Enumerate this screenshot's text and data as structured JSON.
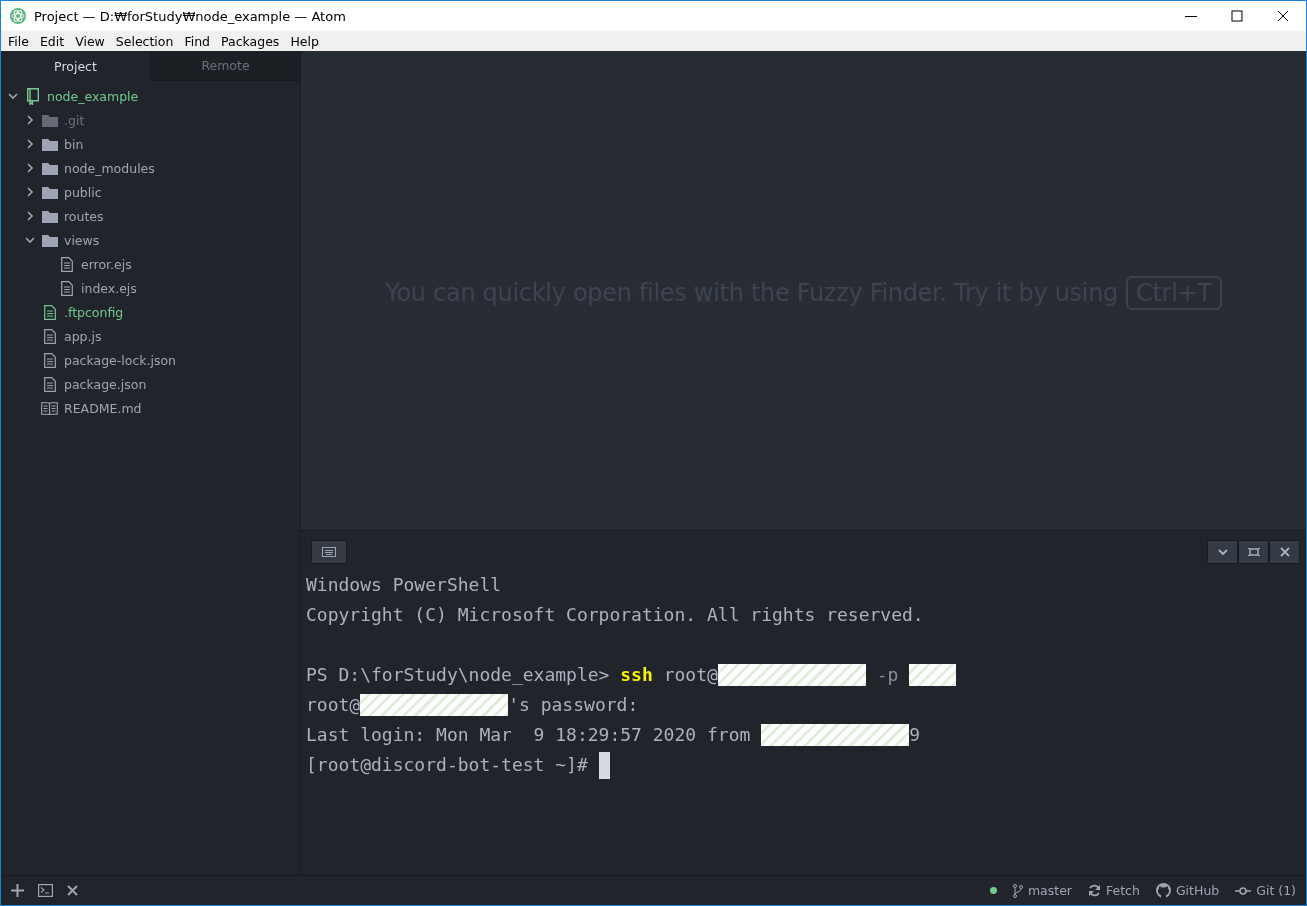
{
  "window": {
    "title": "Project — D:₩forStudy₩node_example — Atom"
  },
  "menu": [
    "File",
    "Edit",
    "View",
    "Selection",
    "Find",
    "Packages",
    "Help"
  ],
  "sidebar": {
    "tabs": [
      {
        "label": "Project",
        "selected": true
      },
      {
        "label": "Remote",
        "selected": false
      }
    ],
    "tree": [
      {
        "name": "node_example",
        "kind": "repo",
        "added": true,
        "ignored": false,
        "expanded": true,
        "children": [
          {
            "name": ".git",
            "kind": "folder",
            "added": false,
            "ignored": true,
            "expanded": false
          },
          {
            "name": "bin",
            "kind": "folder",
            "added": false,
            "ignored": false,
            "expanded": false
          },
          {
            "name": "node_modules",
            "kind": "folder",
            "added": false,
            "ignored": false,
            "expanded": false
          },
          {
            "name": "public",
            "kind": "folder",
            "added": false,
            "ignored": false,
            "expanded": false
          },
          {
            "name": "routes",
            "kind": "folder",
            "added": false,
            "ignored": false,
            "expanded": false
          },
          {
            "name": "views",
            "kind": "folder",
            "added": false,
            "ignored": false,
            "expanded": true,
            "children": [
              {
                "name": "error.ejs",
                "kind": "file",
                "added": false,
                "ignored": false
              },
              {
                "name": "index.ejs",
                "kind": "file",
                "added": false,
                "ignored": false
              }
            ]
          },
          {
            "name": ".ftpconfig",
            "kind": "file",
            "added": true,
            "ignored": false
          },
          {
            "name": "app.js",
            "kind": "file",
            "added": false,
            "ignored": false
          },
          {
            "name": "package-lock.json",
            "kind": "file",
            "added": false,
            "ignored": false
          },
          {
            "name": "package.json",
            "kind": "file",
            "added": false,
            "ignored": false
          },
          {
            "name": "README.md",
            "kind": "readme",
            "added": false,
            "ignored": false
          }
        ]
      }
    ]
  },
  "editor": {
    "hint": "You can quickly open files with the Fuzzy Finder. Try it by using",
    "shortcut": "Ctrl+T"
  },
  "terminal": {
    "blocks": [
      {
        "lines": [
          [
            {
              "kind": "text",
              "text": "Windows PowerShell"
            }
          ],
          [
            {
              "kind": "text",
              "text": "Copyright (C) Microsoft Corporation. All rights reserved."
            }
          ]
        ]
      },
      {
        "lines": [
          [
            {
              "kind": "text",
              "text": "PS D:\\forStudy\\node_example> "
            },
            {
              "kind": "keyword",
              "text": "ssh"
            },
            {
              "kind": "text",
              "text": " root@"
            },
            {
              "kind": "redacted"
            },
            {
              "kind": "dim",
              "text": " -p "
            },
            {
              "kind": "redacted"
            }
          ],
          [
            {
              "kind": "text",
              "text": "root@"
            },
            {
              "kind": "redacted"
            },
            {
              "kind": "text",
              "text": "'s password:"
            }
          ],
          [
            {
              "kind": "text",
              "text": "Last login: Mon Mar  9 18:29:57 2020 from "
            },
            {
              "kind": "redacted"
            },
            {
              "kind": "text",
              "text": "9"
            }
          ],
          [
            {
              "kind": "text",
              "text": "[root@discord-bot-test ~]# "
            },
            {
              "kind": "cursor"
            }
          ]
        ]
      }
    ]
  },
  "status_bar": {
    "branch": "master",
    "fetch": "Fetch",
    "github": "GitHub",
    "git": "Git (1)"
  }
}
